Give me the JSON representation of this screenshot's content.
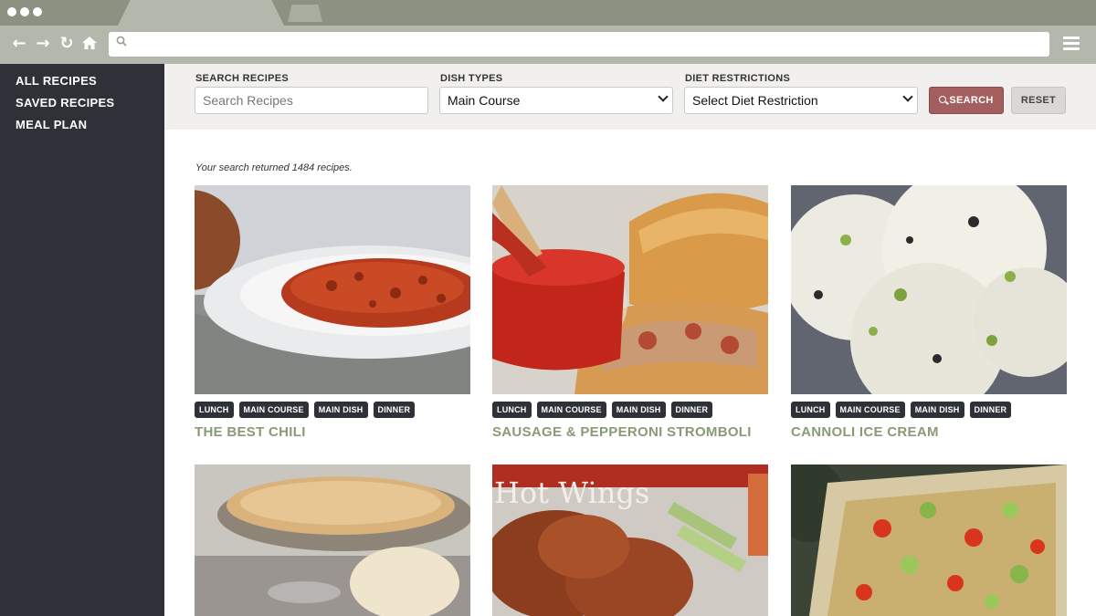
{
  "browser": {
    "address_value": ""
  },
  "sidebar": {
    "items": [
      {
        "label": "ALL RECIPES"
      },
      {
        "label": "SAVED RECIPES"
      },
      {
        "label": "MEAL PLAN"
      }
    ]
  },
  "filters": {
    "search_label": "SEARCH RECIPES",
    "search_placeholder": "Search Recipes",
    "search_value": "",
    "dish_label": "DISH TYPES",
    "dish_selected": "Main Course",
    "diet_label": "DIET RESTRICTIONS",
    "diet_selected": "Select Diet Restriction",
    "search_button": "SEARCH",
    "reset_button": "RESET"
  },
  "results": {
    "summary": "Your search returned 1484 recipes."
  },
  "recipes": [
    {
      "title": "THE BEST CHILI",
      "tags": [
        "LUNCH",
        "MAIN COURSE",
        "MAIN DISH",
        "DINNER"
      ]
    },
    {
      "title": "SAUSAGE & PEPPERONI STROMBOLI",
      "tags": [
        "LUNCH",
        "MAIN COURSE",
        "MAIN DISH",
        "DINNER"
      ]
    },
    {
      "title": "CANNOLI ICE CREAM",
      "tags": [
        "LUNCH",
        "MAIN COURSE",
        "MAIN DISH",
        "DINNER"
      ]
    },
    {
      "image_text": "Hot Wings"
    }
  ],
  "colors": {
    "sidebar_bg": "#2e3238",
    "search_button": "#a35f5d",
    "title_green": "#8a9a78",
    "chrome": "#8c9282"
  }
}
